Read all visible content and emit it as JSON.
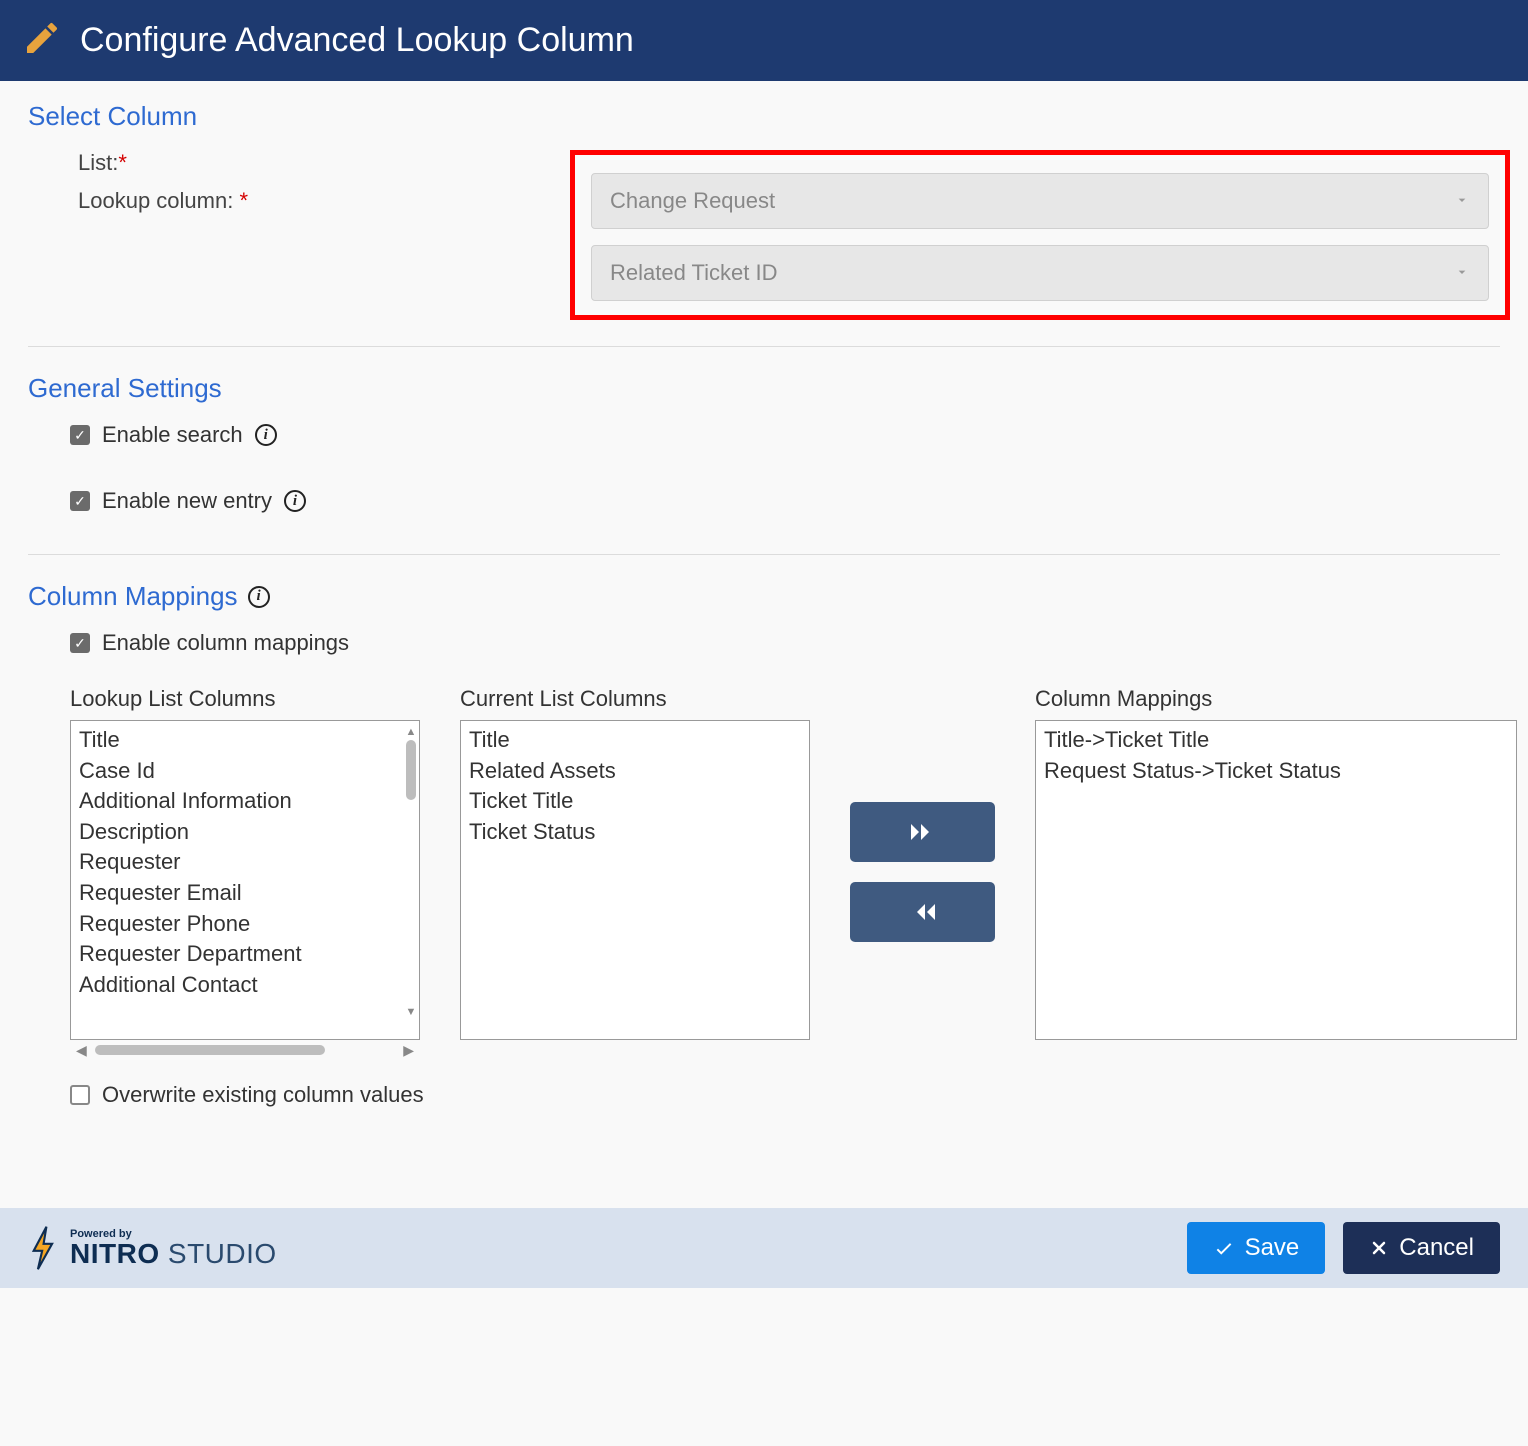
{
  "header": {
    "title": "Configure Advanced Lookup Column"
  },
  "sections": {
    "select_column": {
      "title": "Select Column",
      "list_label": "List:",
      "list_value": "Change Request",
      "lookup_label": "Lookup column: ",
      "lookup_value": "Related Ticket ID"
    },
    "general": {
      "title": "General Settings",
      "enable_search": "Enable search",
      "enable_new_entry": "Enable new entry"
    },
    "mappings": {
      "title": "Column Mappings",
      "enable_label": "Enable column mappings",
      "lookup_cols_label": "Lookup List Columns",
      "current_cols_label": "Current List Columns",
      "mappings_label": "Column Mappings",
      "lookup_cols": [
        "Title",
        "Case Id",
        "Additional Information",
        "Description",
        "Requester",
        "Requester Email",
        "Requester Phone",
        "Requester Department",
        "Additional Contact"
      ],
      "current_cols": [
        "Title",
        "Related Assets",
        "Ticket Title",
        "Ticket Status"
      ],
      "mapped": [
        "Title->Ticket Title",
        "Request Status->Ticket Status"
      ],
      "overwrite_label": "Overwrite existing column values"
    }
  },
  "footer": {
    "powered": "Powered by",
    "brand_bold": "NITRO",
    "brand_light": " STUDIO",
    "save": "Save",
    "cancel": "Cancel"
  }
}
